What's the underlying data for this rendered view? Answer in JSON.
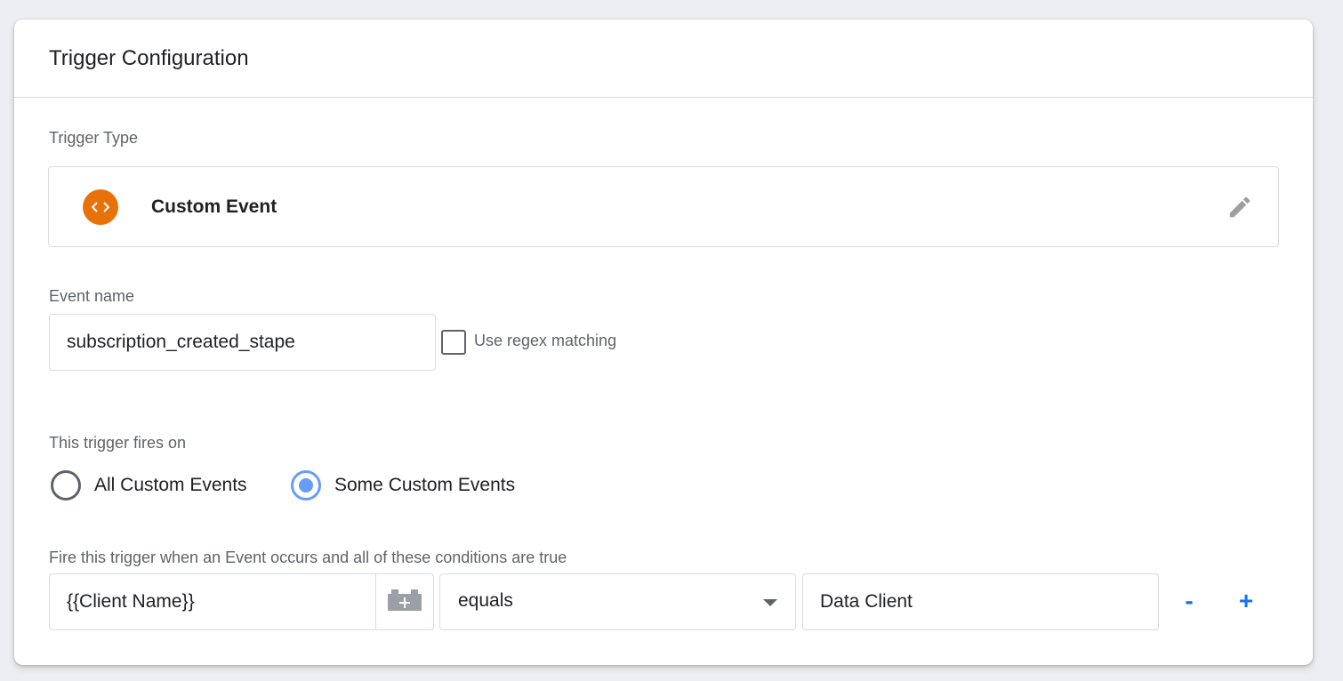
{
  "card": {
    "title": "Trigger Configuration"
  },
  "trigger_type": {
    "label": "Trigger Type",
    "name": "Custom Event",
    "icon": "code-brackets-icon",
    "icon_color": "#e8710a"
  },
  "event_name": {
    "label": "Event name",
    "value": "subscription_created_stape",
    "regex_label": "Use regex matching",
    "regex_checked": false
  },
  "fires_on": {
    "label": "This trigger fires on",
    "options": [
      {
        "label": "All Custom Events",
        "selected": false
      },
      {
        "label": "Some Custom Events",
        "selected": true
      }
    ]
  },
  "condition": {
    "label": "Fire this trigger when an Event occurs and all of these conditions are true",
    "variable": "{{Client Name}}",
    "operator": "equals",
    "value": "Data Client",
    "remove_label": "-",
    "add_label": "+"
  },
  "colors": {
    "accent": "#1a73e8",
    "radio_selected": "#669df6",
    "border": "#dadce0"
  }
}
